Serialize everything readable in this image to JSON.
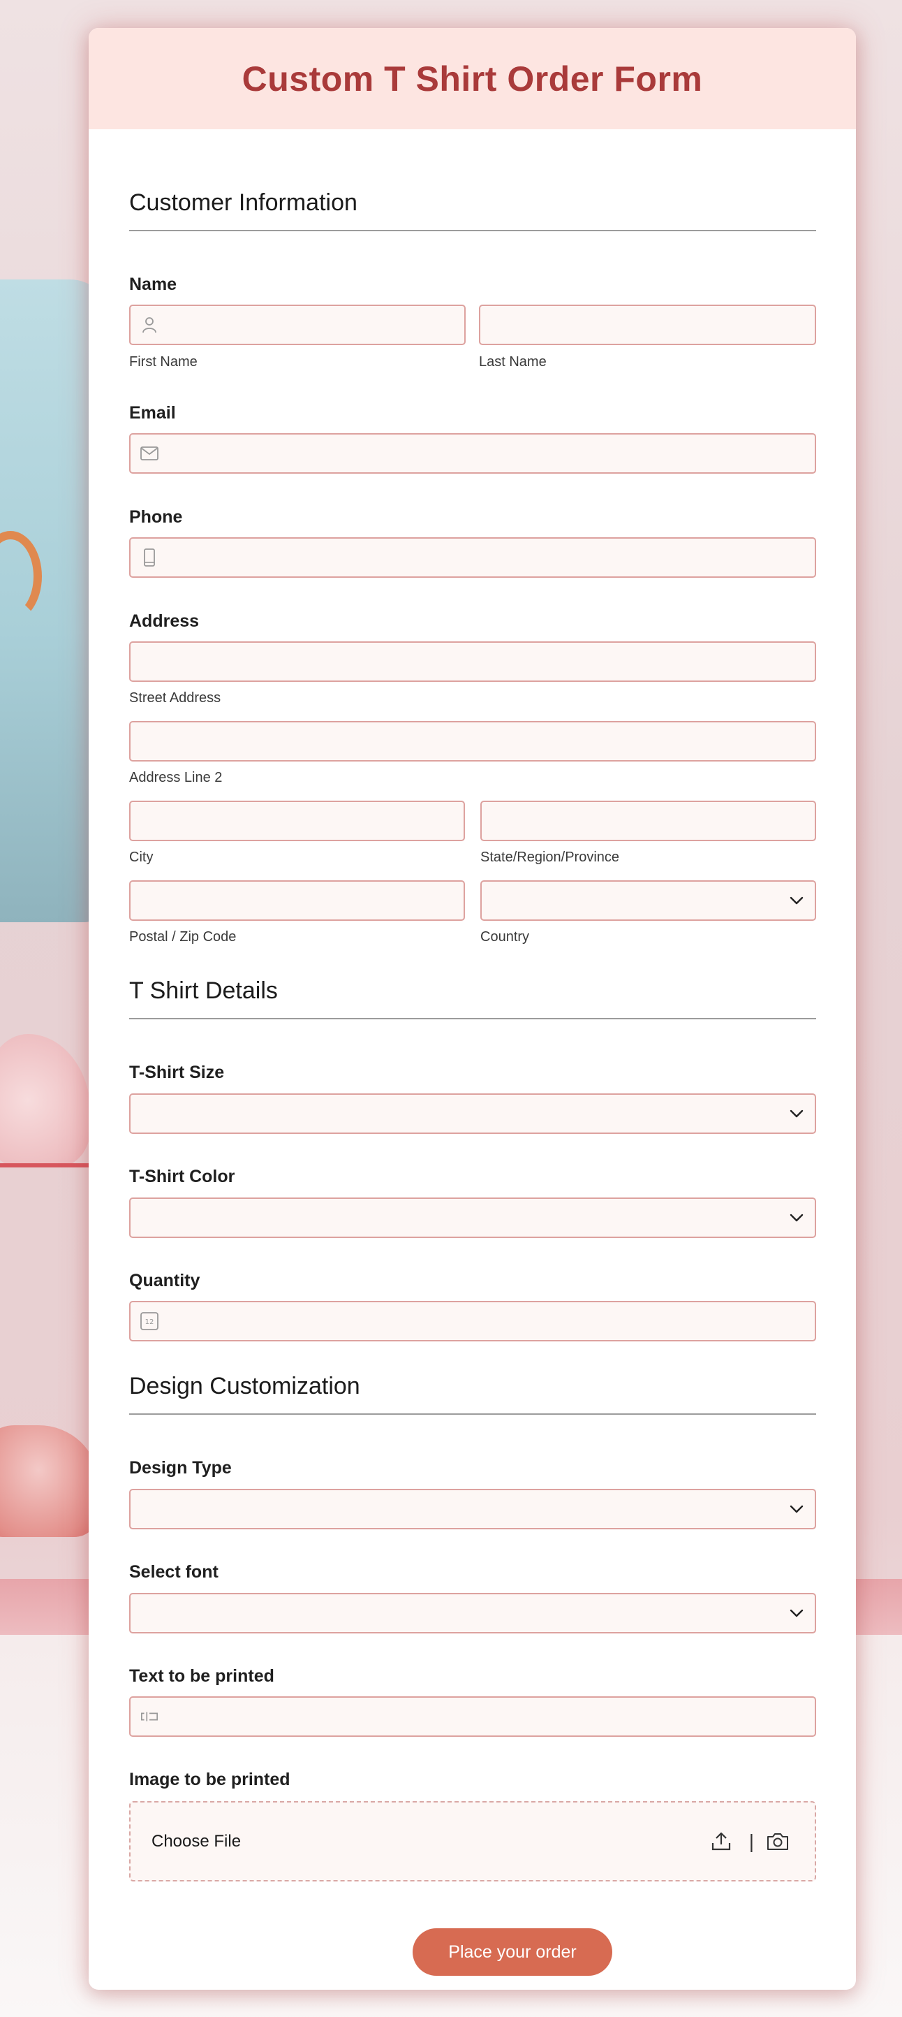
{
  "form": {
    "title": "Custom T Shirt Order Form",
    "submit_label": "Place your order"
  },
  "sections": {
    "customer": "Customer Information",
    "tshirt": "T Shirt Details",
    "design": "Design Customization"
  },
  "fields": {
    "name": {
      "label": "Name",
      "first_sub": "First Name",
      "last_sub": "Last Name",
      "first_value": "",
      "last_value": ""
    },
    "email": {
      "label": "Email",
      "value": ""
    },
    "phone": {
      "label": "Phone",
      "value": ""
    },
    "address": {
      "label": "Address",
      "street_sub": "Street Address",
      "line2_sub": "Address Line 2",
      "city_sub": "City",
      "state_sub": "State/Region/Province",
      "zip_sub": "Postal / Zip Code",
      "country_sub": "Country",
      "country_value": ""
    },
    "size": {
      "label": "T-Shirt Size",
      "value": ""
    },
    "color": {
      "label": "T-Shirt Color",
      "value": ""
    },
    "quantity": {
      "label": "Quantity",
      "value": ""
    },
    "design_type": {
      "label": "Design Type",
      "value": ""
    },
    "font": {
      "label": "Select font",
      "value": ""
    },
    "text": {
      "label": "Text to be printed",
      "value": ""
    },
    "image": {
      "label": "Image to be printed",
      "choose_label": "Choose File",
      "separator": "|"
    }
  },
  "icons": {
    "first_name": "person-icon",
    "email": "envelope-icon",
    "phone": "phone-icon",
    "quantity": "number-icon",
    "text": "text-cursor-icon",
    "upload": "upload-icon",
    "camera": "camera-icon",
    "dropdown": "chevron-down-icon"
  },
  "colors": {
    "title": "#a93a3a",
    "header_bg": "#fde5e1",
    "field_bg": "#fdf7f5",
    "field_border": "#dda29f",
    "button": "#d76b52"
  }
}
